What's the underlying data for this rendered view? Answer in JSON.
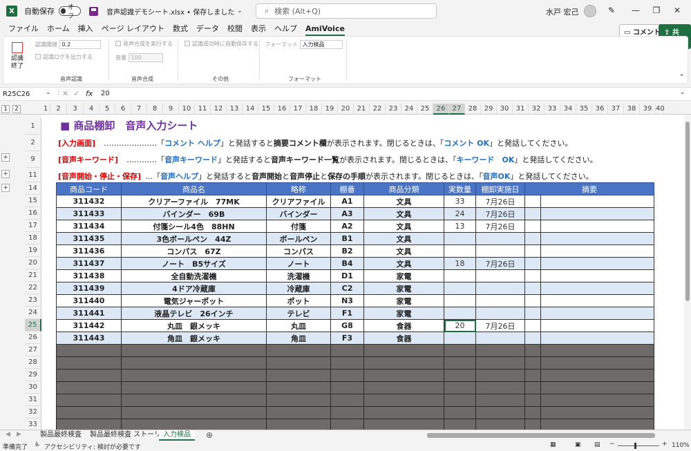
{
  "titlebar": {
    "autosave_label": "自動保存",
    "autosave_state": "オフ",
    "file_title": "音声認識デモシート.xlsx • 保存しました",
    "search_placeholder": "検索 (Alt+Q)",
    "user_name": "水戸 宏己"
  },
  "menu": [
    "ファイル",
    "ホーム",
    "挿入",
    "ページ レイアウト",
    "数式",
    "データ",
    "校閲",
    "表示",
    "ヘルプ",
    "AmiVoice"
  ],
  "menu_active": "AmiVoice",
  "comment_btn": "コメント",
  "share_btn": "共有",
  "ribbon": {
    "recog_end": "認識終了",
    "recog_threshold_label": "認識閾値",
    "recog_threshold_value": "0.2",
    "recog_log_label": "認識ログを出力する",
    "group_recog": "音声認識",
    "tts_label": "音声合成を実行する",
    "volume_label": "音量",
    "volume_value": "100",
    "group_tts": "音声合成",
    "autosave_label": "認識成功時に自動保存する",
    "group_other": "その他",
    "format_label": "フォーマット",
    "format_value": "入力検品",
    "group_format": "フォーマット"
  },
  "formula": {
    "name_box": "R25C26",
    "fx": "fx",
    "value": "20"
  },
  "columns": [
    "1",
    "2",
    "3",
    "4",
    "5",
    "6",
    "7",
    "8",
    "9",
    "10",
    "11",
    "12",
    "13",
    "14",
    "15",
    "16",
    "17",
    "18",
    "19",
    "20",
    "21",
    "22",
    "23",
    "24",
    "25",
    "26",
    "27",
    "28",
    "29",
    "30",
    "31",
    "32",
    "33",
    "34",
    "35",
    "36",
    "37",
    "38",
    "39",
    "40"
  ],
  "rows": [
    "1",
    "2",
    "9",
    "11",
    "14",
    "15",
    "16",
    "17",
    "18",
    "19",
    "20",
    "21",
    "22",
    "23",
    "24",
    "25",
    "26",
    "27",
    "28",
    "29",
    "30",
    "31",
    "32",
    "33"
  ],
  "sheet": {
    "title": "商品棚卸　音声入力シート",
    "line2_tag": "[入力画面]",
    "line2_dots": "…………………",
    "line2_a": "「",
    "line2_kw": "コメント ヘルプ",
    "line2_b": "」と発話すると",
    "line2_bold": "摘要コメント欄",
    "line2_c": "が表示されます。閉じるときは、「",
    "line2_kw2": "コメント OK",
    "line2_d": "」と発話してください。",
    "line9_tag": "[音声キーワード]",
    "line9_dots": "…………",
    "line9_a": "「",
    "line9_kw": "音声キーワード",
    "line9_b": "」と発話すると",
    "line9_bold": "音声キーワード一覧",
    "line9_c": "が表示されます。閉じるときは、「",
    "line9_kw2": "キーワード　OK",
    "line9_d": "」と発話してください。",
    "line11_tag": "[音声開始・停止・保存]",
    "line11_dots": "…",
    "line11_a": "「",
    "line11_kw": "音声ヘルプ",
    "line11_b": "」と発話すると",
    "line11_bold1": "音声開始",
    "line11_and": "と",
    "line11_bold2": "音声停止",
    "line11_and2": "と",
    "line11_bold3": "保存の手順",
    "line11_c": "が表示されます。閉じるときは、「",
    "line11_kw2": "音声OK",
    "line11_d": "」と発話してください。"
  },
  "table": {
    "headers": [
      "商品コード",
      "商品名",
      "略称",
      "棚番",
      "商品分類",
      "実数量",
      "棚卸実施日",
      "摘要"
    ],
    "rows": [
      [
        "311432",
        "クリアーファイル　77MK",
        "クリアファイル",
        "A1",
        "文具",
        "33",
        "7月26日",
        ""
      ],
      [
        "311433",
        "バインダー　69B",
        "バインダー",
        "A3",
        "文具",
        "24",
        "7月26日",
        ""
      ],
      [
        "311434",
        "付箋シール4色　88HN",
        "付箋",
        "A2",
        "文具",
        "13",
        "7月26日",
        ""
      ],
      [
        "311435",
        "3色ボールペン　44Z",
        "ボールペン",
        "B1",
        "文具",
        "",
        "",
        " "
      ],
      [
        "311436",
        "コンパス　67Z",
        "コンパス",
        "B2",
        "文具",
        "",
        "",
        ""
      ],
      [
        "311437",
        "ノート　B5サイズ",
        "ノート",
        "B4",
        "文具",
        "18",
        "7月26日",
        ""
      ],
      [
        "311438",
        "全自動洗濯機",
        "洗濯機",
        "D1",
        "家電",
        "",
        "",
        ""
      ],
      [
        "311439",
        "4ドア冷蔵庫",
        "冷蔵庫",
        "C2",
        "家電",
        "",
        "",
        ""
      ],
      [
        "311440",
        "電気ジャーポット",
        "ポット",
        "N3",
        "家電",
        "",
        "",
        ""
      ],
      [
        "311441",
        "液晶テレビ　26インチ",
        "テレビ",
        "F1",
        "家電",
        "",
        "",
        ""
      ],
      [
        "311442",
        "丸皿　銀メッキ",
        "丸皿",
        "G8",
        "食器",
        "20",
        "7月26日",
        ""
      ],
      [
        "311443",
        "角皿　銀メッキ",
        "角皿",
        "F3",
        "食器",
        "",
        "",
        ""
      ]
    ]
  },
  "tabs": [
    "製品最終検査",
    "製品最終検査 ストーリー",
    "入力検品"
  ],
  "active_tab": "入力検品",
  "status": {
    "ready": "準備完了",
    "accessibility": "アクセシビリティ: 検討が必要です",
    "zoom": "110%"
  },
  "colors": {
    "accent": "#1d6f42",
    "table_header": "#4a74c5",
    "alt_row": "#dce8f6",
    "empty_row": "#6e6a6a",
    "title": "#7030a0",
    "tag_red": "#e00000",
    "keyword_blue": "#1f6fc5"
  }
}
